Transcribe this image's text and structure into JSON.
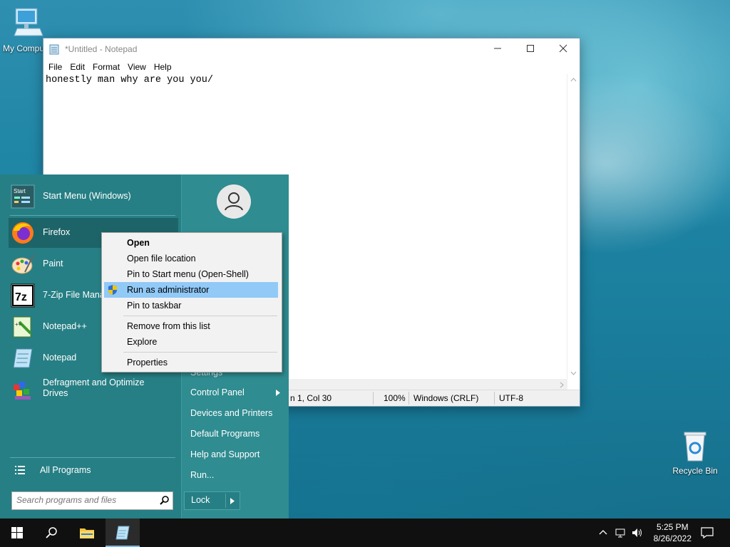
{
  "desktop": {
    "my_computer_label": "My Computer",
    "recycle_bin_label": "Recycle Bin"
  },
  "notepad": {
    "title": "*Untitled - Notepad",
    "menu": [
      "File",
      "Edit",
      "Format",
      "View",
      "Help"
    ],
    "content": "honestly man why are you you/",
    "status": {
      "position": "n 1, Col 30",
      "zoom": "100%",
      "line_endings": "Windows (CRLF)",
      "encoding": "UTF-8"
    }
  },
  "start_menu": {
    "pinned": [
      {
        "label": "Start Menu (Windows)",
        "icon": "start-menu-icon"
      },
      {
        "label": "Firefox",
        "icon": "firefox-icon"
      },
      {
        "label": "Paint",
        "icon": "paint-icon"
      },
      {
        "label": "7-Zip File Mana",
        "icon": "7zip-icon"
      },
      {
        "label": "Notepad++",
        "icon": "notepadpp-icon"
      },
      {
        "label": "Notepad",
        "icon": "notepad-icon"
      },
      {
        "label": "Defragment and Optimize\nDrives",
        "icon": "defrag-icon"
      }
    ],
    "all_programs": "All Programs",
    "search_placeholder": "Search programs and files",
    "right_items": {
      "settings": "Settings",
      "control_panel": "Control Panel",
      "devices_printers": "Devices and Printers",
      "default_programs": "Default Programs",
      "help_support": "Help and Support",
      "run": "Run..."
    },
    "lock_label": "Lock",
    "start_icon_text": "Start"
  },
  "context_menu": {
    "items": [
      "Open",
      "Open file location",
      "Pin to Start menu (Open-Shell)",
      "Run as administrator",
      "Pin to taskbar",
      "Remove from this list",
      "Explore",
      "Properties"
    ],
    "selected_index": 3
  },
  "taskbar": {
    "time": "5:25 PM",
    "date": "8/26/2022"
  },
  "colors": {
    "start_menu_left": "#267f84",
    "start_menu_right": "#2f8c90",
    "context_highlight": "#91c9f7",
    "taskbar": "#101010"
  }
}
